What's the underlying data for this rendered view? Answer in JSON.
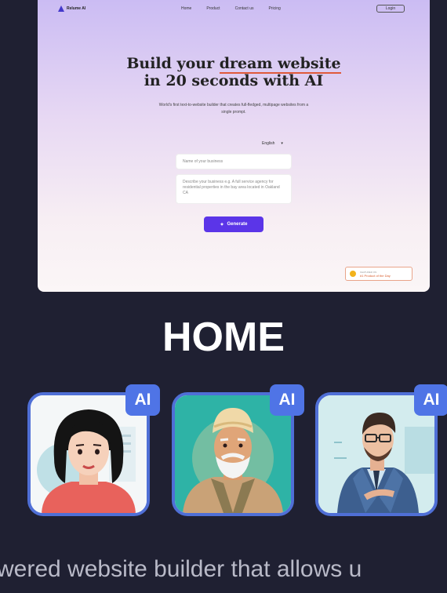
{
  "preview": {
    "logo_text": "Relume AI",
    "nav": [
      "Home",
      "Product",
      "Contact us",
      "Pricing"
    ],
    "login_label": "Login",
    "headline_line1_a": "Build your ",
    "headline_line1_b": "dream website",
    "headline_line2": "in 20 seconds with AI",
    "subtitle": "World's first text-to-website builder that creates full-fledged, multipage websites from a single prompt.",
    "language": "English",
    "business_name_placeholder": "Name of your business",
    "description_placeholder": "Describe your business e.g. A full service agency for residential properties in the bay area located in Oakland CA",
    "generate_label": "Generate",
    "producthunt_small": "FEATURED ON",
    "producthunt_label": "#1 Product of the Day"
  },
  "section_title": "HOME",
  "cards": [
    {
      "badge": "AI",
      "avatar": "woman-avatar"
    },
    {
      "badge": "AI",
      "avatar": "elderly-man-avatar"
    },
    {
      "badge": "AI",
      "avatar": "businessman-avatar"
    }
  ],
  "bottom_text": "wered website builder that allows u",
  "colors": {
    "background": "#1f2032",
    "accent": "#4f74e6",
    "generate": "#5b35e8"
  }
}
